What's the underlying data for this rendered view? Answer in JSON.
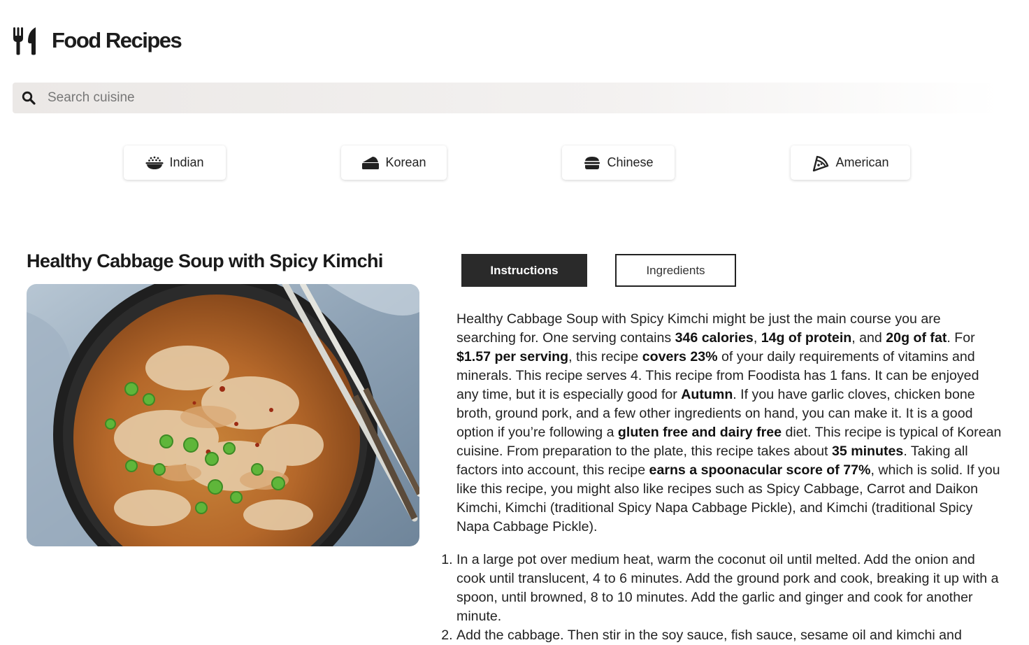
{
  "app": {
    "title": "Food Recipes",
    "logo_icon": "utensils-icon"
  },
  "search": {
    "placeholder": "Search cuisine",
    "value": "",
    "icon": "search-icon"
  },
  "categories": [
    {
      "label": "Indian",
      "icon": "bowl-rice-icon"
    },
    {
      "label": "Korean",
      "icon": "cake-slice-icon"
    },
    {
      "label": "Chinese",
      "icon": "burger-icon"
    },
    {
      "label": "American",
      "icon": "pizza-slice-icon"
    }
  ],
  "recipe": {
    "title": "Healthy Cabbage Soup with Spicy Kimchi",
    "image_alt": "bowl of cabbage kimchi soup with green onions and chopsticks",
    "tabs": {
      "active": "Instructions",
      "inactive": "Ingredients"
    },
    "summary": [
      {
        "t": "Healthy Cabbage Soup with Spicy Kimchi might be just the main course you are searching for. One serving contains "
      },
      {
        "t": "346 calories",
        "b": true
      },
      {
        "t": ", "
      },
      {
        "t": "14g of protein",
        "b": true
      },
      {
        "t": ", and "
      },
      {
        "t": "20g of fat",
        "b": true
      },
      {
        "t": ". For "
      },
      {
        "t": "$1.57 per serving",
        "b": true
      },
      {
        "t": ", this recipe "
      },
      {
        "t": "covers 23%",
        "b": true
      },
      {
        "t": " of your daily requirements of vitamins and minerals. This recipe serves 4. This recipe from Foodista has 1 fans. It can be enjoyed any time, but it is especially good for "
      },
      {
        "t": "Autumn",
        "b": true
      },
      {
        "t": ". If you have garlic cloves, chicken bone broth, ground pork, and a few other ingredients on hand, you can make it. It is a good option if you’re following a "
      },
      {
        "t": "gluten free and dairy free",
        "b": true
      },
      {
        "t": " diet. This recipe is typical of Korean cuisine. From preparation to the plate, this recipe takes about "
      },
      {
        "t": "35 minutes",
        "b": true
      },
      {
        "t": ". Taking all factors into account, this recipe "
      },
      {
        "t": "earns a spoonacular score of 77%",
        "b": true
      },
      {
        "t": ", which is solid. If you like this recipe, you might also like recipes such as Spicy Cabbage, Carrot and Daikon Kimchi, Kimchi (traditional Spicy Napa Cabbage Pickle), and Kimchi (traditional Spicy Napa Cabbage Pickle)."
      }
    ],
    "steps": [
      "In a large pot over medium heat, warm the coconut oil until melted. Add the onion and cook until translucent, 4 to 6 minutes. Add the ground pork and cook, breaking it up with a spoon, until browned, 8 to 10 minutes. Add the garlic and ginger and cook for another minute.",
      "Add the cabbage. Then stir in the soy sauce, fish sauce, sesame oil and kimchi and"
    ]
  }
}
